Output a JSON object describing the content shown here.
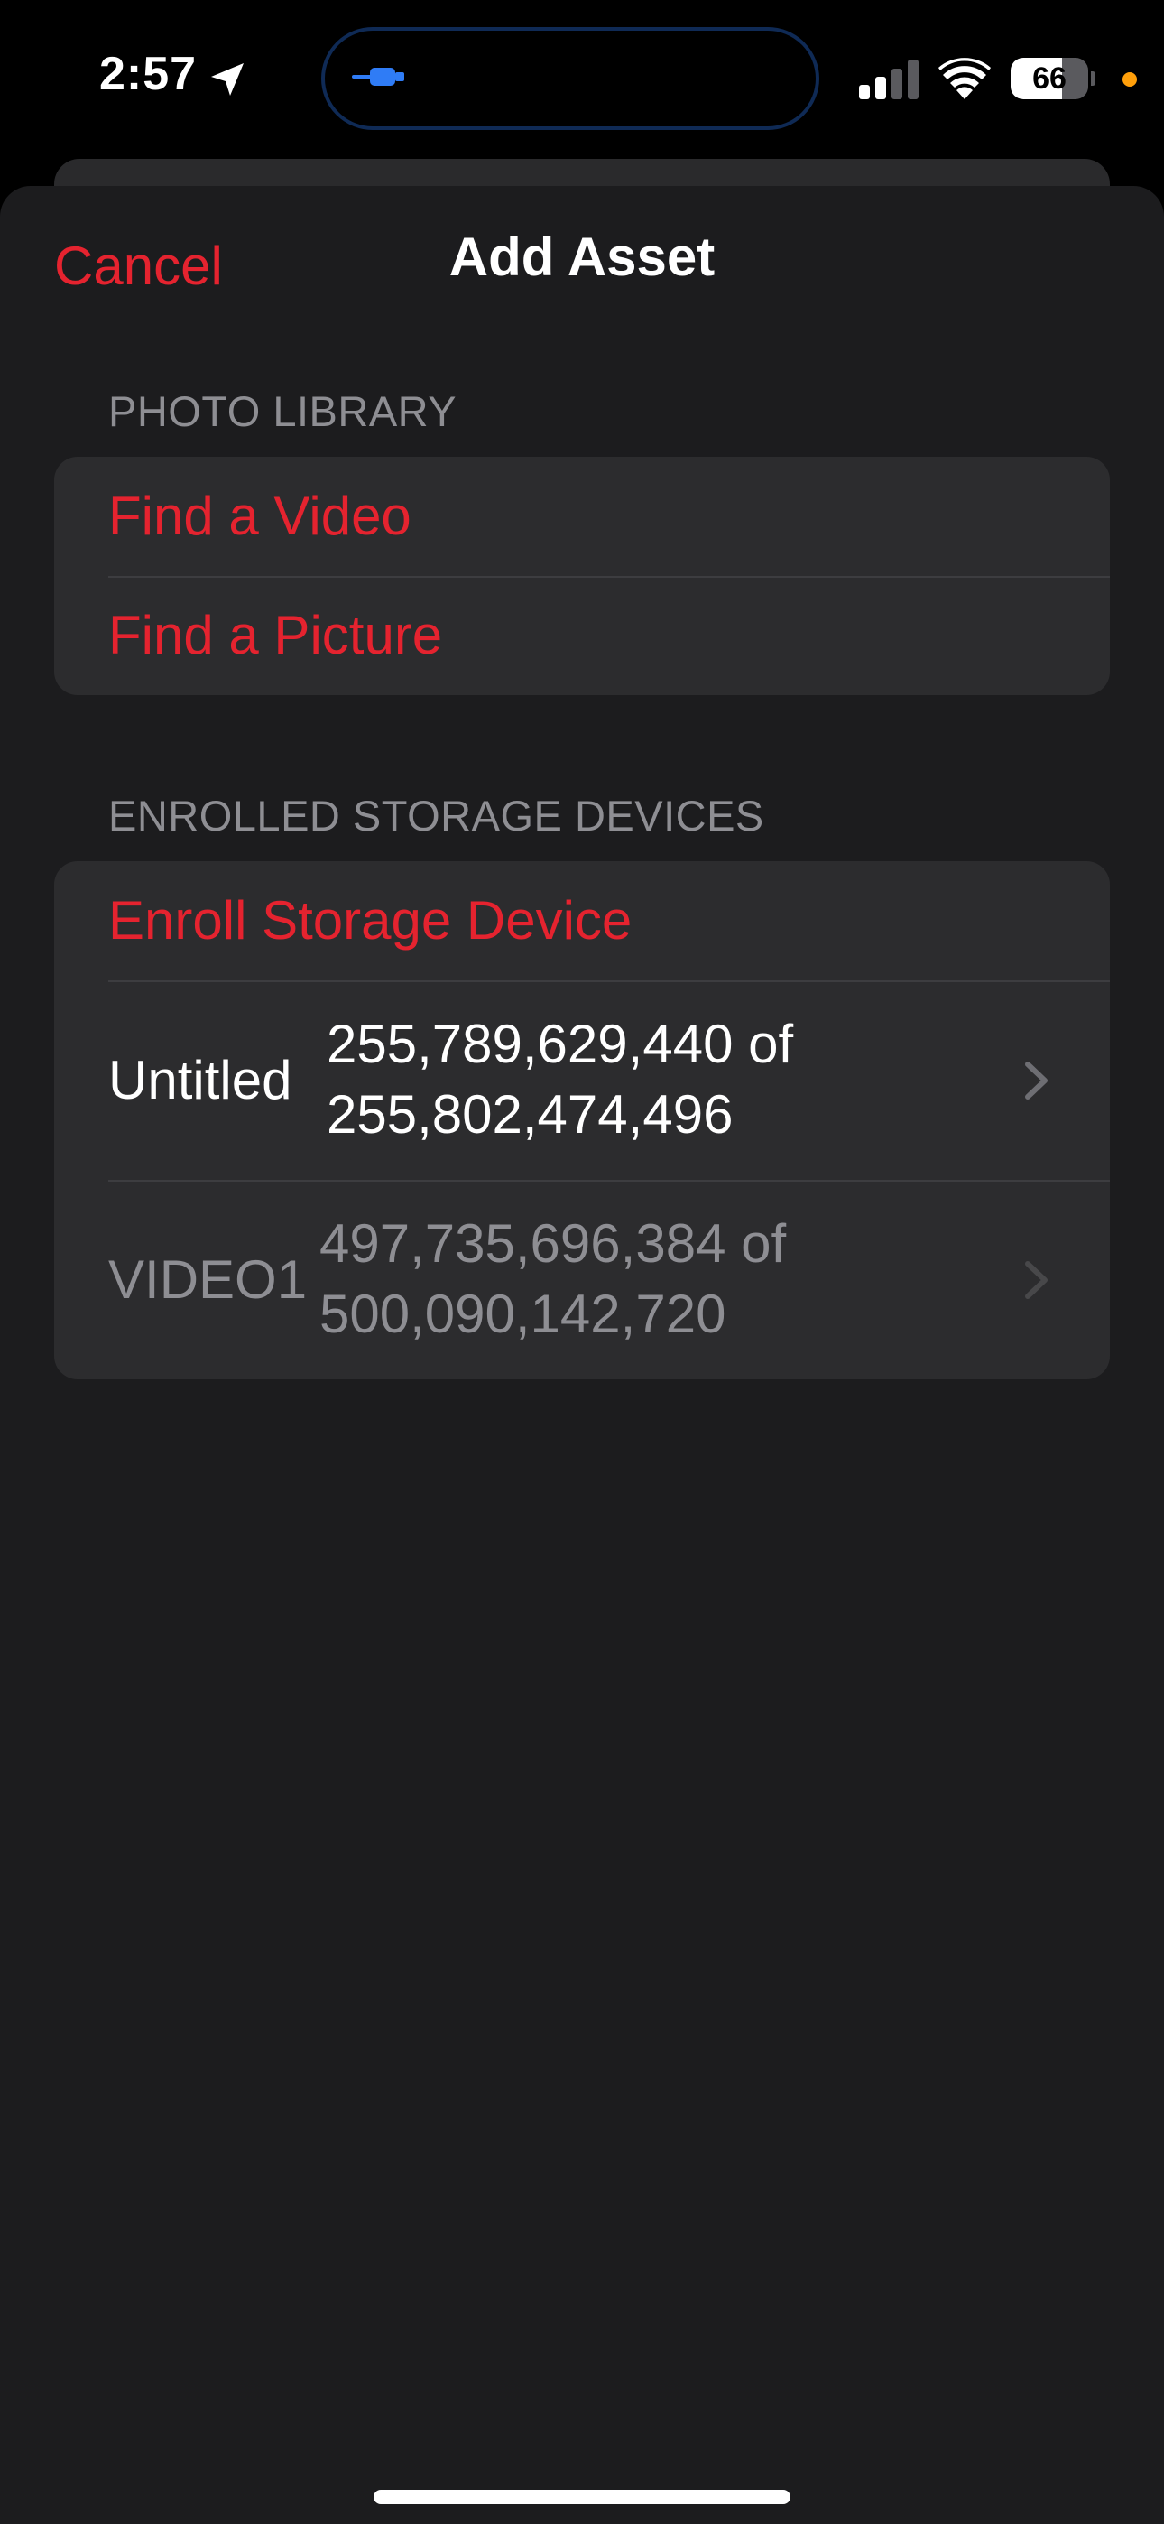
{
  "status_bar": {
    "time": "2:57",
    "battery_level": "66",
    "battery_fraction": 0.66,
    "icons": [
      "location-arrow-icon",
      "usb-connection-icon",
      "cellular-signal-icon",
      "wifi-icon",
      "battery-icon",
      "privacy-indicator-dot"
    ]
  },
  "nav": {
    "cancel_label": "Cancel",
    "title": "Add Asset"
  },
  "photo_library": {
    "header": "PHOTO LIBRARY",
    "items": [
      {
        "label": "Find a Video"
      },
      {
        "label": "Find a Picture"
      }
    ]
  },
  "storage": {
    "header": "ENROLLED STORAGE DEVICES",
    "enroll_label": "Enroll Storage Device",
    "devices": [
      {
        "name": "Untitled",
        "capacity": "255,789,629,440 of 255,802,474,496",
        "enabled": true
      },
      {
        "name": "VIDEO1",
        "capacity": "497,735,696,384 of 500,090,142,720",
        "enabled": false
      }
    ]
  },
  "colors": {
    "accent": "#e5232f",
    "background": "#1c1c1e",
    "group_background": "#2c2c2e",
    "secondary_text": "#8e8e93",
    "disabled_text": "#8e8e93",
    "island_icon": "#2f7cf6",
    "privacy_dot": "#ff9f0a"
  }
}
